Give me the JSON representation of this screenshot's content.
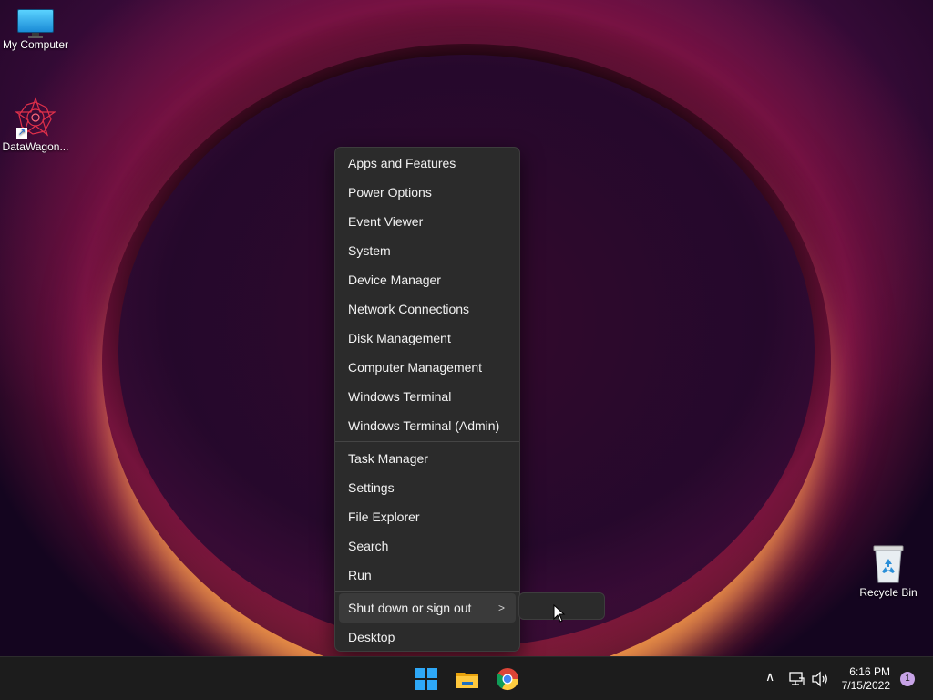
{
  "desktop": {
    "icons": [
      {
        "label": "My Computer",
        "icon": "monitor-icon"
      },
      {
        "label": "DataWagon...",
        "icon": "datawagon-logo-icon"
      },
      {
        "label": "Recycle Bin",
        "icon": "recycle-bin-icon"
      }
    ]
  },
  "context_menu": {
    "group1": [
      {
        "label": "Apps and Features"
      },
      {
        "label": "Power Options"
      },
      {
        "label": "Event Viewer"
      },
      {
        "label": "System"
      },
      {
        "label": "Device Manager"
      },
      {
        "label": "Network Connections"
      },
      {
        "label": "Disk Management"
      },
      {
        "label": "Computer Management"
      },
      {
        "label": "Windows Terminal"
      },
      {
        "label": "Windows Terminal (Admin)"
      }
    ],
    "group2": [
      {
        "label": "Task Manager"
      },
      {
        "label": "Settings"
      },
      {
        "label": "File Explorer"
      },
      {
        "label": "Search"
      },
      {
        "label": "Run"
      }
    ],
    "group3": [
      {
        "label": "Shut down or sign out",
        "chevron": ">"
      },
      {
        "label": "Desktop"
      }
    ]
  },
  "taskbar": {
    "apps": [
      {
        "icon": "windows-start-icon"
      },
      {
        "icon": "file-explorer-icon"
      },
      {
        "icon": "chrome-icon"
      }
    ],
    "tray": {
      "time": "6:16 PM",
      "date": "7/15/2022",
      "notification_count": "1"
    }
  },
  "colors": {
    "menu_bg": "#2b2b2b",
    "taskbar_bg": "#1c1c1c",
    "menu_text": "#f2f2f2"
  }
}
